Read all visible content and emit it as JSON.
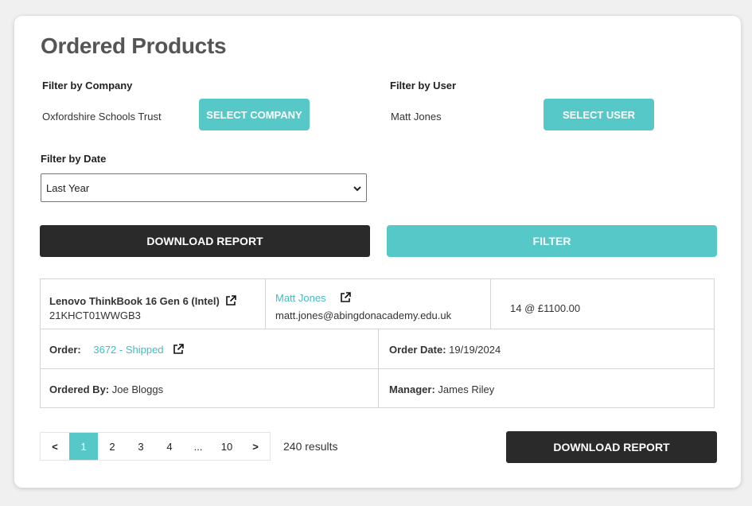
{
  "page": {
    "title": "Ordered Products"
  },
  "filters": {
    "company": {
      "label": "Filter by Company",
      "value": "Oxfordshire Schools Trust",
      "button": "SELECT COMPANY"
    },
    "user": {
      "label": "Filter by User",
      "value": "Matt Jones",
      "button": "SELECT USER"
    },
    "date": {
      "label": "Filter by Date",
      "selected": "Last Year"
    }
  },
  "actions": {
    "download_label": "DOWNLOAD REPORT",
    "filter_label": "FILTER"
  },
  "order": {
    "product_name": "Lenovo ThinkBook 16 Gen 6 (Intel)",
    "product_sku": "21KHCT01WWGB3",
    "user_name": "Matt Jones",
    "user_email": "matt.jones@abingdonacademy.edu.uk",
    "quantity_price": "14 @ £1100.00",
    "order_label": "Order:",
    "order_value": "3672 - Shipped",
    "order_date_label": "Order Date:",
    "order_date_value": "19/19/2024",
    "ordered_by_label": "Ordered By:",
    "ordered_by_value": "Joe Bloggs",
    "manager_label": "Manager:",
    "manager_value": "James Riley"
  },
  "pagination": {
    "prev": "<",
    "pages": [
      "1",
      "2",
      "3",
      "4",
      "...",
      "10"
    ],
    "next": ">",
    "results": "240 results"
  },
  "colors": {
    "accent": "#56c8c8",
    "dark": "#2a2a2a",
    "link": "#43bcc0"
  }
}
